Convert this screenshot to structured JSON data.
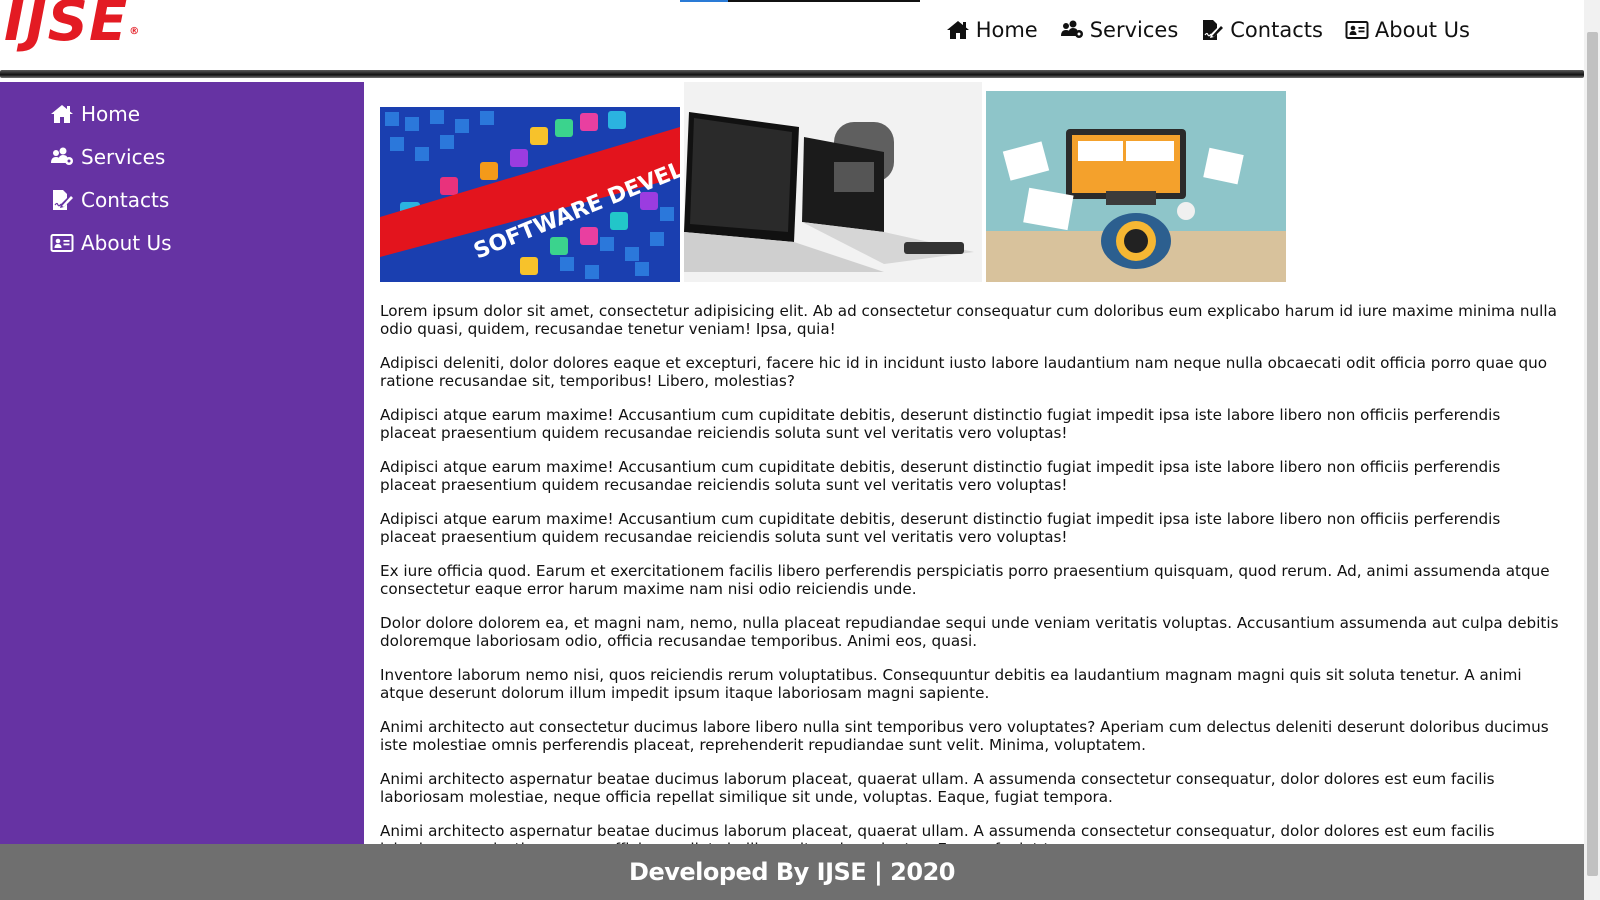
{
  "header": {
    "logo_text": "IJSE",
    "logo_mark": "®",
    "nav": [
      {
        "label": "Home",
        "icon": "home-icon"
      },
      {
        "label": "Services",
        "icon": "users-cog-icon"
      },
      {
        "label": "Contacts",
        "icon": "file-signature-icon"
      },
      {
        "label": "About Us",
        "icon": "address-card-icon"
      }
    ]
  },
  "sidebar": {
    "items": [
      {
        "label": "Home",
        "icon": "home-icon"
      },
      {
        "label": "Services",
        "icon": "users-cog-icon"
      },
      {
        "label": "Contacts",
        "icon": "file-signature-icon"
      },
      {
        "label": "About Us",
        "icon": "address-card-icon"
      }
    ]
  },
  "images": {
    "banner1_text": "SOFTWARE DEVELOPMENT"
  },
  "content": {
    "paragraphs": [
      "Lorem ipsum dolor sit amet, consectetur adipisicing elit. Ab ad consectetur consequatur cum doloribus eum explicabo harum id iure maxime minima nulla odio quasi, quidem, recusandae tenetur veniam! Ipsa, quia!",
      "Adipisci deleniti, dolor dolores eaque et excepturi, facere hic id in incidunt iusto labore laudantium nam neque nulla obcaecati odit officia porro quae quo ratione recusandae sit, temporibus! Libero, molestias?",
      "Adipisci atque earum maxime! Accusantium cum cupiditate debitis, deserunt distinctio fugiat impedit ipsa iste labore libero non officiis perferendis placeat praesentium quidem recusandae reiciendis soluta sunt vel veritatis vero voluptas!",
      "Adipisci atque earum maxime! Accusantium cum cupiditate debitis, deserunt distinctio fugiat impedit ipsa iste labore libero non officiis perferendis placeat praesentium quidem recusandae reiciendis soluta sunt vel veritatis vero voluptas!",
      "Adipisci atque earum maxime! Accusantium cum cupiditate debitis, deserunt distinctio fugiat impedit ipsa iste labore libero non officiis perferendis placeat praesentium quidem recusandae reiciendis soluta sunt vel veritatis vero voluptas!",
      "Ex iure officia quod. Earum et exercitationem facilis libero perferendis perspiciatis porro praesentium quisquam, quod rerum. Ad, animi assumenda atque consectetur eaque error harum maxime nam nisi odio reiciendis unde.",
      "Dolor dolore dolorem ea, et magni nam, nemo, nulla placeat repudiandae sequi unde veniam veritatis voluptas. Accusantium assumenda aut culpa debitis doloremque laboriosam odio, officia recusandae temporibus. Animi eos, quasi.",
      "Inventore laborum nemo nisi, quos reiciendis rerum voluptatibus. Consequuntur debitis ea laudantium magnam magni quis sit soluta tenetur. A animi atque deserunt dolorum illum impedit ipsum itaque laboriosam magni sapiente.",
      "Animi architecto aut consectetur ducimus labore libero nulla sint temporibus vero voluptates? Aperiam cum delectus deleniti deserunt doloribus ducimus iste molestiae omnis perferendis placeat, reprehenderit repudiandae sunt velit. Minima, voluptatem.",
      "Animi architecto aspernatur beatae ducimus laborum placeat, quaerat ullam. A assumenda consectetur consequatur, dolor dolores est eum facilis laboriosam molestiae, neque officia repellat similique sit unde, voluptas. Eaque, fugiat tempora.",
      "Animi architecto aspernatur beatae ducimus laborum placeat, quaerat ullam. A assumenda consectetur consequatur, dolor dolores est eum facilis laboriosam molestiae, neque officia repellat similique sit unde, voluptas. Eaque, fugiat tempora."
    ]
  },
  "footer": {
    "text": "Developed By IJSE | 2020"
  },
  "colors": {
    "logo": "#e31b23",
    "sidebar": "#6633a3",
    "footer": "#6f6f6f"
  }
}
